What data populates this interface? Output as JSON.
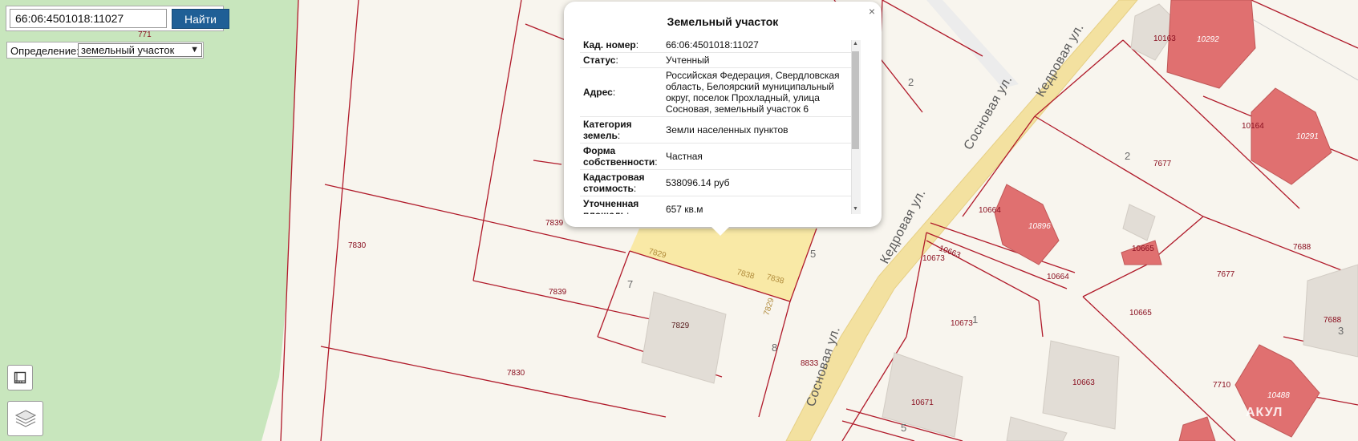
{
  "search": {
    "value": "66:06:4501018:11027",
    "button_label": "Найти"
  },
  "definition": {
    "label": "Определение:",
    "selected": "земельный участок"
  },
  "popup": {
    "title": "Земельный участок",
    "close_glyph": "×",
    "rows": [
      {
        "key": "Кад. номер",
        "value": "66:06:4501018:11027"
      },
      {
        "key": "Статус",
        "value": "Учтенный"
      },
      {
        "key": "Адрес",
        "value": "Российская Федерация, Свердловская область, Белоярский муниципальный округ, поселок Прохладный, улица Сосновая, земельный участок 6"
      },
      {
        "key": "Категория земель",
        "value": "Земли населенных пунктов"
      },
      {
        "key": "Форма собственности",
        "value": "Частная"
      },
      {
        "key": "Кадастровая стоимость",
        "value": "538096.14 руб"
      },
      {
        "key": "Уточненная площадь",
        "value": "657 кв.м"
      }
    ]
  },
  "map": {
    "plot_labels": [
      "771",
      "7830",
      "7839",
      "7839",
      "7830",
      "7829",
      "7838",
      "7838",
      "7829",
      "8833",
      "10163",
      "10164",
      "10664",
      "10663",
      "10673",
      "10664",
      "10665",
      "10665",
      "10673",
      "10663",
      "10671",
      "7677",
      "7677",
      "7688",
      "7688",
      "7710"
    ],
    "house_labels": [
      "7829",
      "10292",
      "10291",
      "10896",
      "10488"
    ],
    "house_numbers": [
      "2",
      "2",
      "5",
      "7",
      "8",
      "1",
      "3",
      "5"
    ],
    "streets": [
      "Сосновая ул.",
      "Кедровая ул.",
      "Кедровая ул.",
      "Сосновая ул."
    ],
    "watermark": "АКУЛ"
  },
  "icons": {
    "ruler": "ruler-icon",
    "layers": "layers-icon",
    "scroll_up": "▲",
    "scroll_down": "▼",
    "select_arrow": "▼"
  },
  "colors": {
    "forest": "#c8e6bd",
    "boundary": "#b01a2a",
    "selected_plot": "#f9e9a6",
    "road": "#f3e1a0",
    "building": "#e2ddd6",
    "building_red": "#e07070",
    "button": "#1f5f96"
  }
}
